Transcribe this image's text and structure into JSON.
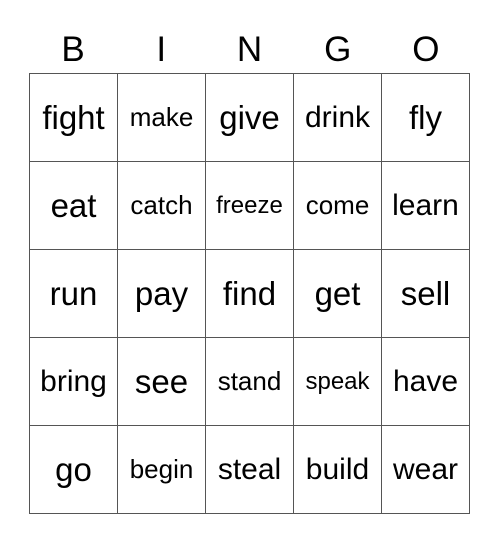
{
  "header": [
    "B",
    "I",
    "N",
    "G",
    "O"
  ],
  "rows": [
    [
      "fight",
      "make",
      "give",
      "drink",
      "fly"
    ],
    [
      "eat",
      "catch",
      "freeze",
      "come",
      "learn"
    ],
    [
      "run",
      "pay",
      "find",
      "get",
      "sell"
    ],
    [
      "bring",
      "see",
      "stand",
      "speak",
      "have"
    ],
    [
      "go",
      "begin",
      "steal",
      "build",
      "wear"
    ]
  ]
}
